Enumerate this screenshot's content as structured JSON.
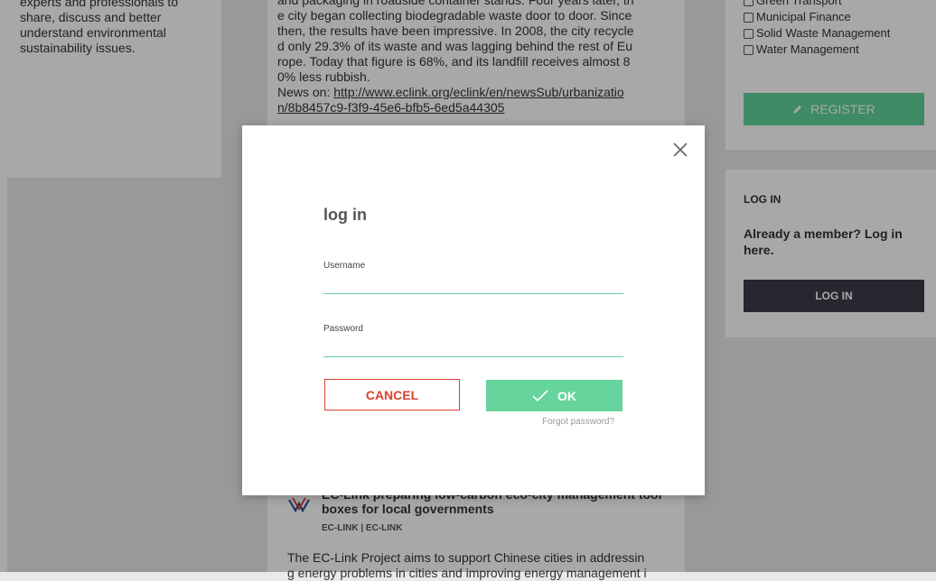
{
  "left_card": {
    "text_lines": [
      "experts and professionals to",
      "share, discuss and better",
      "understand environmental",
      "sustainability issues."
    ]
  },
  "article": {
    "lines": [
      "and packaging in roadside container stands. Four years later, th",
      "e city began collecting biodegradable waste door to door. Since",
      "then, the results have been impressive. In 2008, the city recycle",
      "d only 29.3% of its waste and was lagging behind the rest of Eu",
      "rope. Today that figure is 68%, and its landfill receives almost 8",
      "0% less rubbish."
    ],
    "news_prefix": "News on: ",
    "link_line1": "http://www.eclink.org/eclink/en/newsSub/urbanizatio",
    "link_line2": "n/8b8457c9-f3f9-45e6-bfb5-6ed5a44305"
  },
  "news_item": {
    "title_line1": "EC-Link preparing low-carbon eco-city management tool",
    "title_line2": "boxes for local governments",
    "meta": "EC-LINK | EC-LINK",
    "body_line1": "The EC-Link Project aims to support Chinese cities in addressin",
    "body_line2": "g energy problems in cities and improving energy management i"
  },
  "sidebar": {
    "categories": [
      "Green Transport",
      "Municipal Finance",
      "Solid Waste Management",
      "Water Management"
    ],
    "register_label": "REGISTER",
    "login_heading": "LOG IN",
    "login_subtitle": "Already a member? Log in here.",
    "login_button": "LOG IN"
  },
  "modal": {
    "title": "log in",
    "username_label": "Username",
    "username_value": "",
    "password_label": "Password",
    "password_value": "",
    "cancel_label": "CANCEL",
    "ok_label": "OK",
    "forgot_label": "Forgot password?"
  },
  "colors": {
    "accent_green": "#66d49c",
    "danger_red": "#d9412e",
    "dark_button": "#3e3b48"
  },
  "icons": {
    "close": "close-icon",
    "check": "check-icon",
    "pencil": "pencil-icon",
    "logo": "ec-link-logo-icon"
  }
}
